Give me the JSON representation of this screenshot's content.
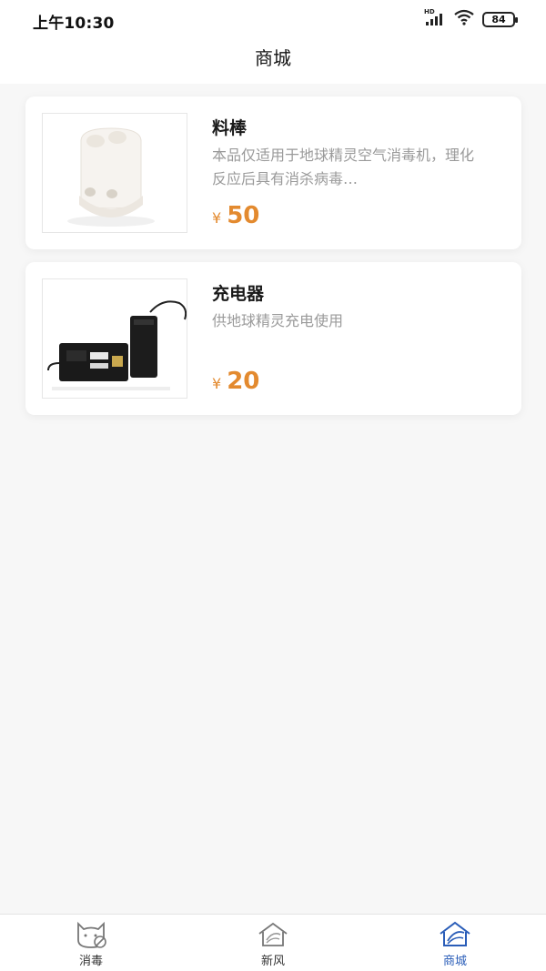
{
  "status_bar": {
    "time": "上午10:30",
    "battery": "84",
    "signal_label": "HD"
  },
  "nav": {
    "title": "商城"
  },
  "products": [
    {
      "name": "料棒",
      "description": "本品仅适用于地球精灵空气消毒机，理化反应后具有消杀病毒…",
      "currency": "¥",
      "price": "50"
    },
    {
      "name": "充电器",
      "description": "供地球精灵充电使用",
      "currency": "¥",
      "price": "20"
    }
  ],
  "tabbar": {
    "tabs": [
      {
        "label": "消毒",
        "icon": "cat-disinfect-icon"
      },
      {
        "label": "新风",
        "icon": "fresh-air-house-icon"
      },
      {
        "label": "商城",
        "icon": "shop-house-icon",
        "active": true
      }
    ]
  },
  "colors": {
    "accent": "#2a5db8",
    "price": "#e38a2f"
  }
}
